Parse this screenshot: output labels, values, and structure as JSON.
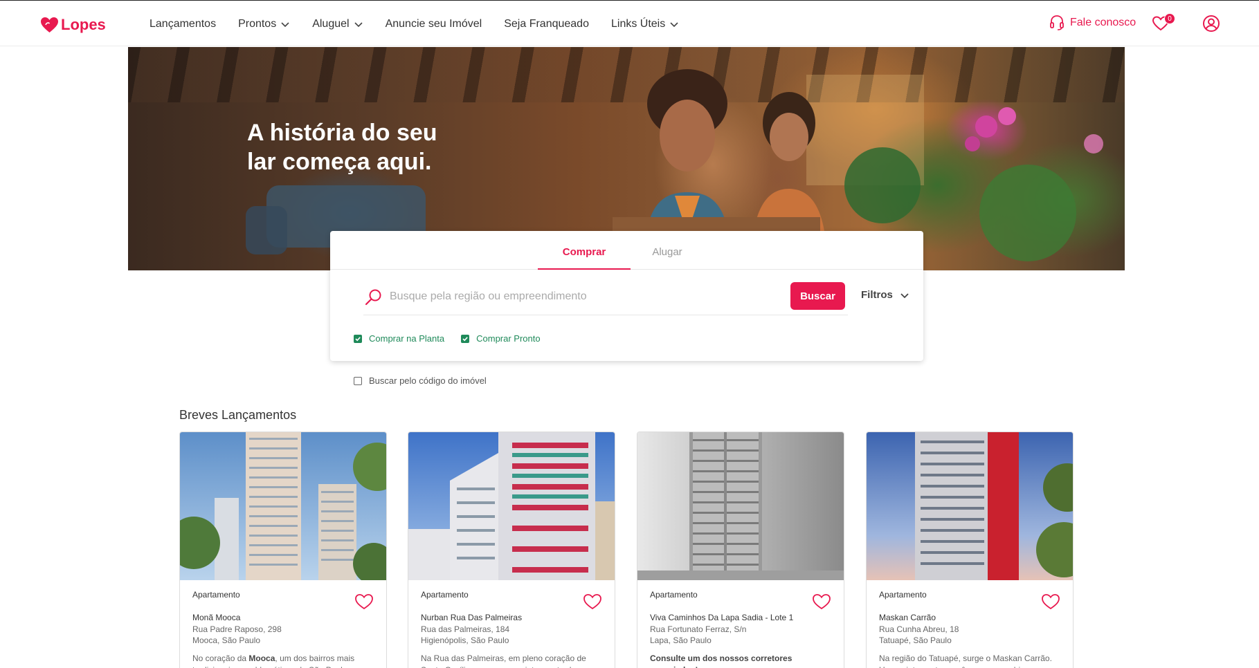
{
  "header": {
    "logo_text": "Lopes",
    "nav": [
      {
        "label": "Lançamentos",
        "dropdown": false
      },
      {
        "label": "Prontos",
        "dropdown": true
      },
      {
        "label": "Aluguel",
        "dropdown": true
      },
      {
        "label": "Anuncie seu Imóvel",
        "dropdown": false
      },
      {
        "label": "Seja Franqueado",
        "dropdown": false
      },
      {
        "label": "Links Úteis",
        "dropdown": true
      }
    ],
    "contact_label": "Fale conosco",
    "favorites_count": "0"
  },
  "hero": {
    "title": "A história do seu lar começa aqui."
  },
  "search": {
    "tabs": [
      "Comprar",
      "Alugar"
    ],
    "active_tab": "Comprar",
    "placeholder": "Busque pela região ou empreendimento",
    "value": "",
    "button_label": "Buscar",
    "filters_label": "Filtros",
    "checkboxes": [
      {
        "label": "Comprar na Planta",
        "checked": true
      },
      {
        "label": "Comprar Pronto",
        "checked": true
      }
    ],
    "code_search_label": "Buscar pelo código do imóvel"
  },
  "section": {
    "title": "Breves Lançamentos"
  },
  "cards": [
    {
      "type": "Apartamento",
      "name": "Monã Mooca",
      "address_line1": "Rua Padre Raposo, 298",
      "address_line2": "Mooca, São Paulo",
      "desc_prefix": "No coração da ",
      "desc_bold": "Mooca",
      "desc_suffix": ", um dos bairros mais tradicionais e emblemáticos de São Paulo"
    },
    {
      "type": "Apartamento",
      "name": "Nurban Rua Das Palmeiras",
      "address_line1": "Rua das Palmeiras, 184",
      "address_line2": "Higienópolis, São Paulo",
      "desc_prefix": "Na Rua das Palmeiras, em pleno coração de Santa Cecília, nasce um projeto que traduz o",
      "desc_bold": "",
      "desc_suffix": ""
    },
    {
      "type": "Apartamento",
      "name": "Viva Caminhos Da Lapa Sadia - Lote 1",
      "address_line1": "Rua Fortunato Ferraz, S/n",
      "address_line2": "Lapa, São Paulo",
      "desc_prefix": "",
      "desc_bold": "Consulte um dos nossos corretores associados!",
      "desc_suffix": ""
    },
    {
      "type": "Apartamento",
      "name": "Maskan Carrão",
      "address_line1": "Rua Cunha Abreu, 18",
      "address_line2": "Tatuapé, São Paulo",
      "desc_prefix": "Na região do Tatuapé, surge o Maskan Carrão. Um projeto contemporâneo que combina",
      "desc_bold": "",
      "desc_suffix": ""
    }
  ],
  "colors": {
    "brand": "#e8194f",
    "check_green": "#1f8a5a"
  }
}
